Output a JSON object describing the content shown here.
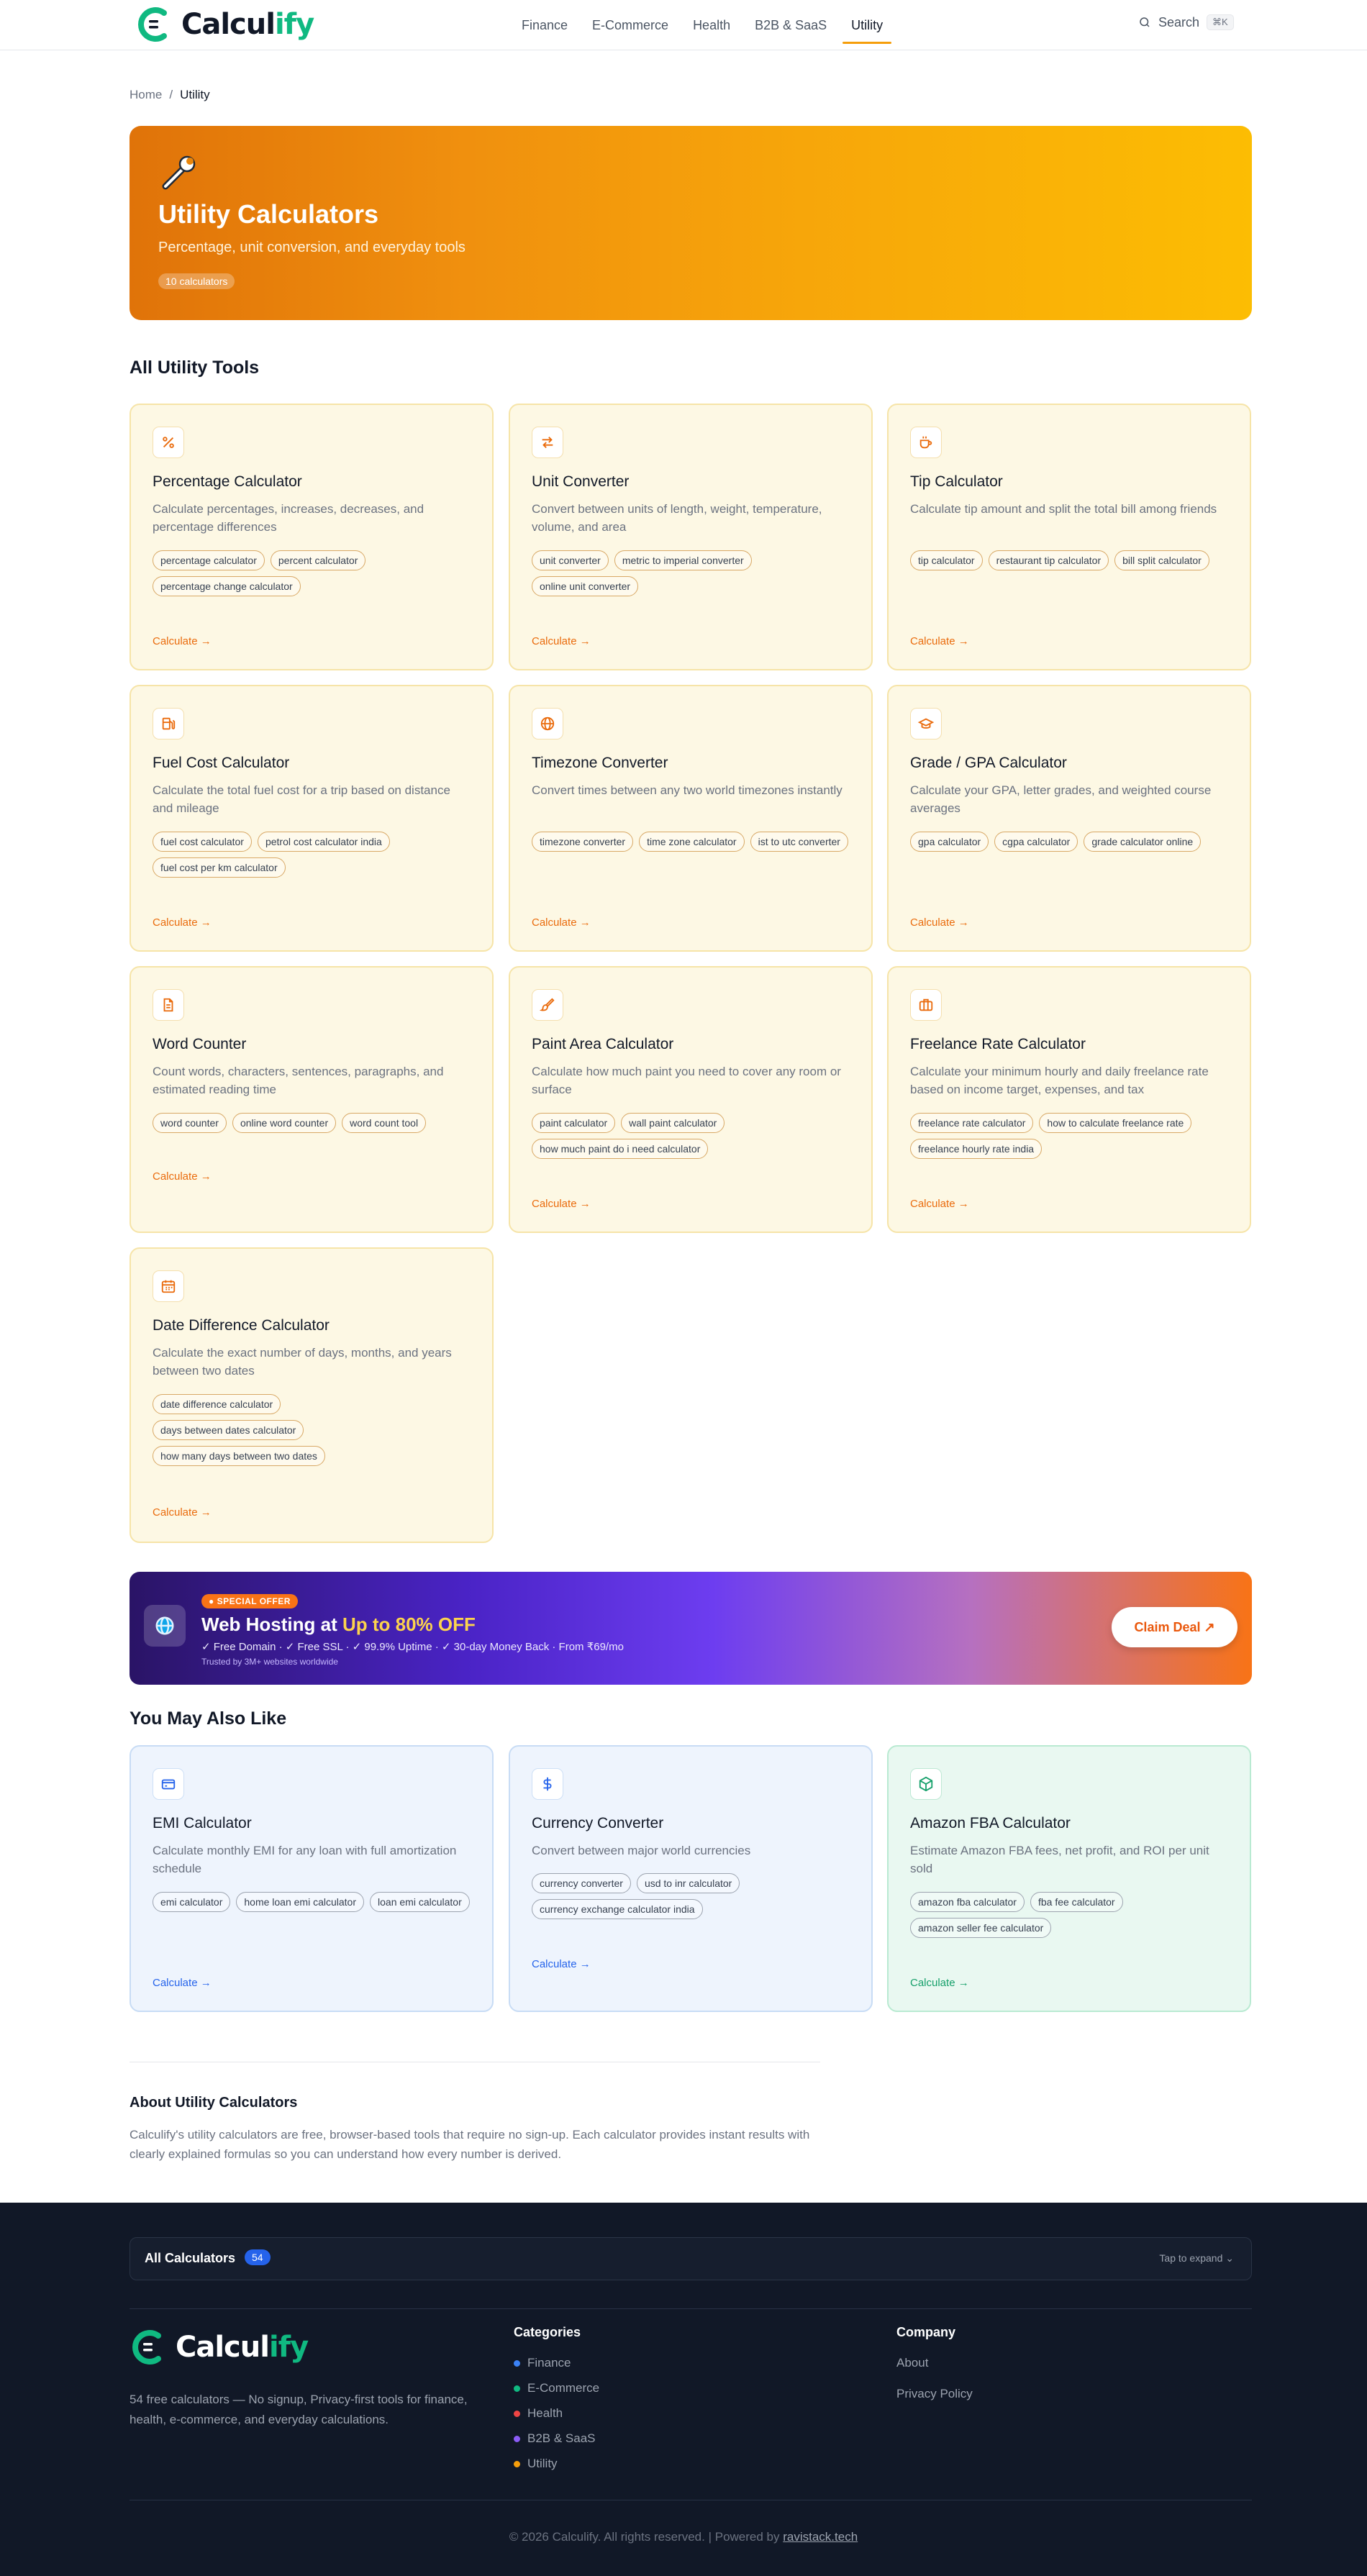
{
  "header": {
    "logo_part1": "Calcul",
    "logo_part2": "ify",
    "nav": [
      "Finance",
      "E-Commerce",
      "Health",
      "B2B & SaaS",
      "Utility"
    ],
    "active_nav": "Utility",
    "search_label": "Search",
    "search_shortcut": "⌘K"
  },
  "breadcrumb": {
    "home": "Home",
    "sep": "/",
    "current": "Utility"
  },
  "hero": {
    "title": "Utility Calculators",
    "subtitle": "Percentage, unit conversion, and everyday tools",
    "badge": "10 calculators"
  },
  "all_tools_title": "All Utility Tools",
  "tools": [
    {
      "icon": "percent-icon",
      "title": "Percentage Calculator",
      "desc": "Calculate percentages, increases, decreases, and percentage differences",
      "tags": [
        "percentage calculator",
        "percent calculator",
        "percentage change calculator"
      ],
      "link": "Calculate →"
    },
    {
      "icon": "arrows-swap-icon",
      "title": "Unit Converter",
      "desc": "Convert between units of length, weight, temperature, volume, and area",
      "tags": [
        "unit converter",
        "metric to imperial converter",
        "online unit converter"
      ],
      "link": "Calculate →"
    },
    {
      "icon": "coffee-cup-icon",
      "title": "Tip Calculator",
      "desc": "Calculate tip amount and split the total bill among friends",
      "tags": [
        "tip calculator",
        "restaurant tip calculator",
        "bill split calculator"
      ],
      "link": "Calculate →"
    },
    {
      "icon": "fuel-pump-icon",
      "title": "Fuel Cost Calculator",
      "desc": "Calculate the total fuel cost for a trip based on distance and mileage",
      "tags": [
        "fuel cost calculator",
        "petrol cost calculator india",
        "fuel cost per km calculator"
      ],
      "link": "Calculate →"
    },
    {
      "icon": "globe-icon",
      "title": "Timezone Converter",
      "desc": "Convert times between any two world timezones instantly",
      "tags": [
        "timezone converter",
        "time zone calculator",
        "ist to utc converter"
      ],
      "link": "Calculate →"
    },
    {
      "icon": "graduation-cap-icon",
      "title": "Grade / GPA Calculator",
      "desc": "Calculate your GPA, letter grades, and weighted course averages",
      "tags": [
        "gpa calculator",
        "cgpa calculator",
        "grade calculator online"
      ],
      "link": "Calculate →"
    },
    {
      "icon": "document-icon",
      "title": "Word Counter",
      "desc": "Count words, characters, sentences, paragraphs, and estimated reading time",
      "tags": [
        "word counter",
        "online word counter",
        "word count tool"
      ],
      "link": "Calculate →"
    },
    {
      "icon": "paintbrush-icon",
      "title": "Paint Area Calculator",
      "desc": "Calculate how much paint you need to cover any room or surface",
      "tags": [
        "paint calculator",
        "wall paint calculator",
        "how much paint do i need calculator"
      ],
      "link": "Calculate →"
    },
    {
      "icon": "briefcase-icon",
      "title": "Freelance Rate Calculator",
      "desc": "Calculate your minimum hourly and daily freelance rate based on income target, expenses, and tax",
      "tags": [
        "freelance rate calculator",
        "how to calculate freelance rate",
        "freelance hourly rate india"
      ],
      "link": "Calculate →"
    },
    {
      "icon": "calendar-icon",
      "title": "Date Difference Calculator",
      "desc": "Calculate the exact number of days, months, and years between two dates",
      "tags": [
        "date difference calculator",
        "days between dates calculator",
        "how many days between two dates"
      ],
      "link": "Calculate →"
    }
  ],
  "ad": {
    "pill": "● SPECIAL OFFER",
    "title_a": "Web Hosting at ",
    "title_b": "Up to 80% OFF",
    "features": "✓ Free Domain  ·  ✓ Free SSL  ·  ✓ 99.9% Uptime  ·  ✓ 30-day Money Back  ·  From ₹69/mo",
    "trust": "Trusted by 3M+ websites worldwide",
    "button": "Claim Deal ↗"
  },
  "also_like_title": "You May Also Like",
  "also_like": [
    {
      "icon": "credit-card-icon",
      "title": "EMI Calculator",
      "desc": "Calculate monthly EMI for any loan with full amortization schedule",
      "tags": [
        "emi calculator",
        "home loan emi calculator",
        "loan emi calculator"
      ],
      "link": "Calculate →",
      "theme": "blue"
    },
    {
      "icon": "dollar-icon",
      "title": "Currency Converter",
      "desc": "Convert between major world currencies",
      "tags": [
        "currency converter",
        "usd to inr calculator",
        "currency exchange calculator india"
      ],
      "link": "Calculate →",
      "theme": "blue"
    },
    {
      "icon": "package-icon",
      "title": "Amazon FBA Calculator",
      "desc": "Estimate Amazon FBA fees, net profit, and ROI per unit sold",
      "tags": [
        "amazon fba calculator",
        "fba fee calculator",
        "amazon seller fee calculator"
      ],
      "link": "Calculate →",
      "theme": "green"
    }
  ],
  "about": {
    "title": "About Utility Calculators",
    "text": "Calculify's utility calculators are free, browser-based tools that require no sign-up. Each calculator provides instant results with clearly explained formulas so you can understand how every number is derived."
  },
  "footer": {
    "all_label": "All Calculators",
    "all_count": "54",
    "expand": "Tap to expand",
    "tagline": "54 free calculators — No signup, Privacy-first tools for finance, health, e-commerce, and everyday calculations.",
    "categories_title": "Categories",
    "categories": [
      {
        "label": "Finance",
        "color": "#3b82f6"
      },
      {
        "label": "E-Commerce",
        "color": "#10b981"
      },
      {
        "label": "Health",
        "color": "#ef4444"
      },
      {
        "label": "B2B & SaaS",
        "color": "#8b5cf6"
      },
      {
        "label": "Utility",
        "color": "#f59e0b"
      }
    ],
    "company_title": "Company",
    "company": [
      "About",
      "Privacy Policy"
    ],
    "copyright": "© 2026 Calculify. All rights reserved. | Powered by ",
    "powered_link": "ravistack.tech"
  },
  "colors": {
    "accent": "#f59e0b",
    "brand": "#10b981",
    "footer_bg": "#111827"
  }
}
